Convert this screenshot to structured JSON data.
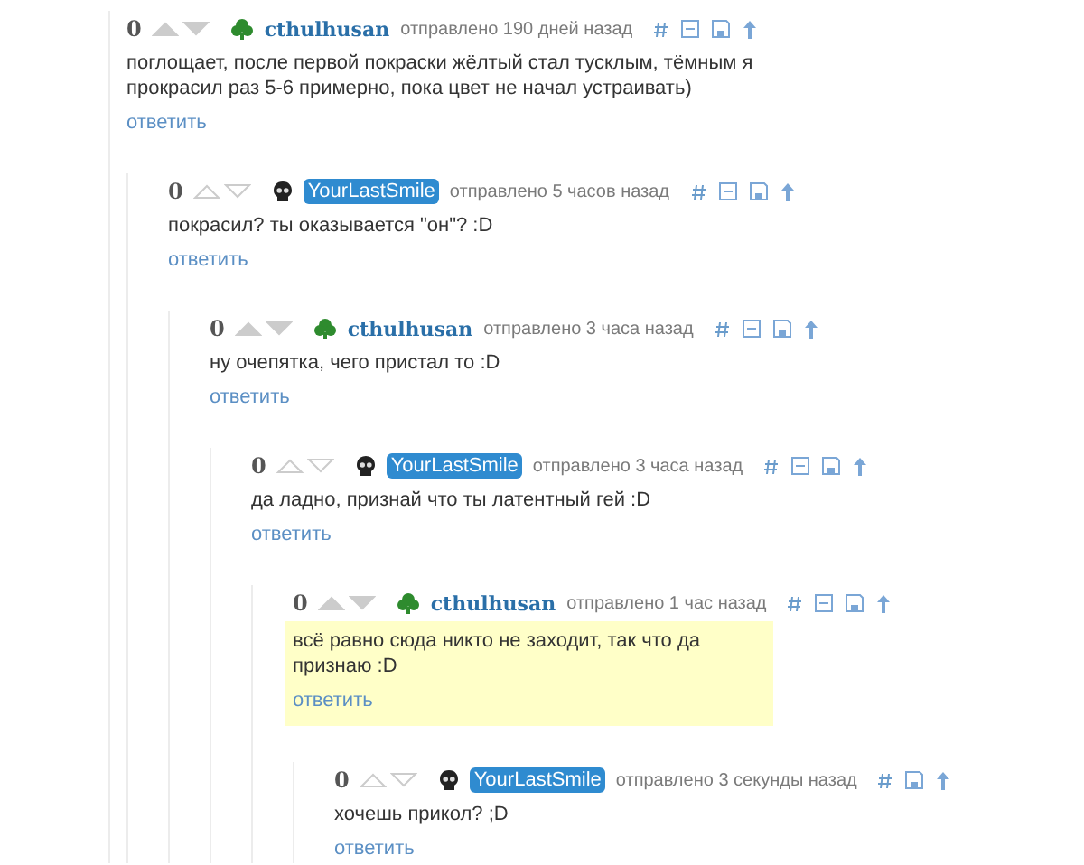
{
  "comments": [
    {
      "score": "0",
      "votable": true,
      "author": {
        "name": "cthulhusan",
        "kind": "plain"
      },
      "posted": "отправлено 190 дней назад",
      "collapsible": true,
      "highlighted": false,
      "text": "поглощает, после первой покраски жёлтый стал тусклым, тёмным я прокрасил раз 5-6 примерно, пока цвет не начал устраивать)",
      "reply": "ответить",
      "children": [
        {
          "score": "0",
          "votable": false,
          "author": {
            "name": "YourLastSmile",
            "kind": "self"
          },
          "posted": "отправлено 5 часов назад",
          "collapsible": true,
          "highlighted": false,
          "text": "покрасил? ты оказывается \"он\"? :D",
          "reply": "ответить",
          "children": [
            {
              "score": "0",
              "votable": true,
              "author": {
                "name": "cthulhusan",
                "kind": "plain"
              },
              "posted": "отправлено 3 часа назад",
              "collapsible": true,
              "highlighted": false,
              "text": "ну очепятка, чего пристал то :D",
              "reply": "ответить",
              "children": [
                {
                  "score": "0",
                  "votable": false,
                  "author": {
                    "name": "YourLastSmile",
                    "kind": "self"
                  },
                  "posted": "отправлено 3 часа назад",
                  "collapsible": true,
                  "highlighted": false,
                  "text": "да ладно, признай что ты латентный гей :D",
                  "reply": "ответить",
                  "children": [
                    {
                      "score": "0",
                      "votable": true,
                      "author": {
                        "name": "cthulhusan",
                        "kind": "plain"
                      },
                      "posted": "отправлено 1 час назад",
                      "collapsible": true,
                      "highlighted": true,
                      "text": "всё равно сюда никто не заходит, так что да признаю :D",
                      "reply": "ответить",
                      "children": [
                        {
                          "score": "0",
                          "votable": false,
                          "author": {
                            "name": "YourLastSmile",
                            "kind": "self"
                          },
                          "posted": "отправлено 3 секунды назад",
                          "collapsible": false,
                          "highlighted": false,
                          "text": "хочешь прикол? ;D",
                          "reply": "ответить"
                        }
                      ]
                    }
                  ]
                }
              ]
            }
          ]
        }
      ]
    }
  ]
}
